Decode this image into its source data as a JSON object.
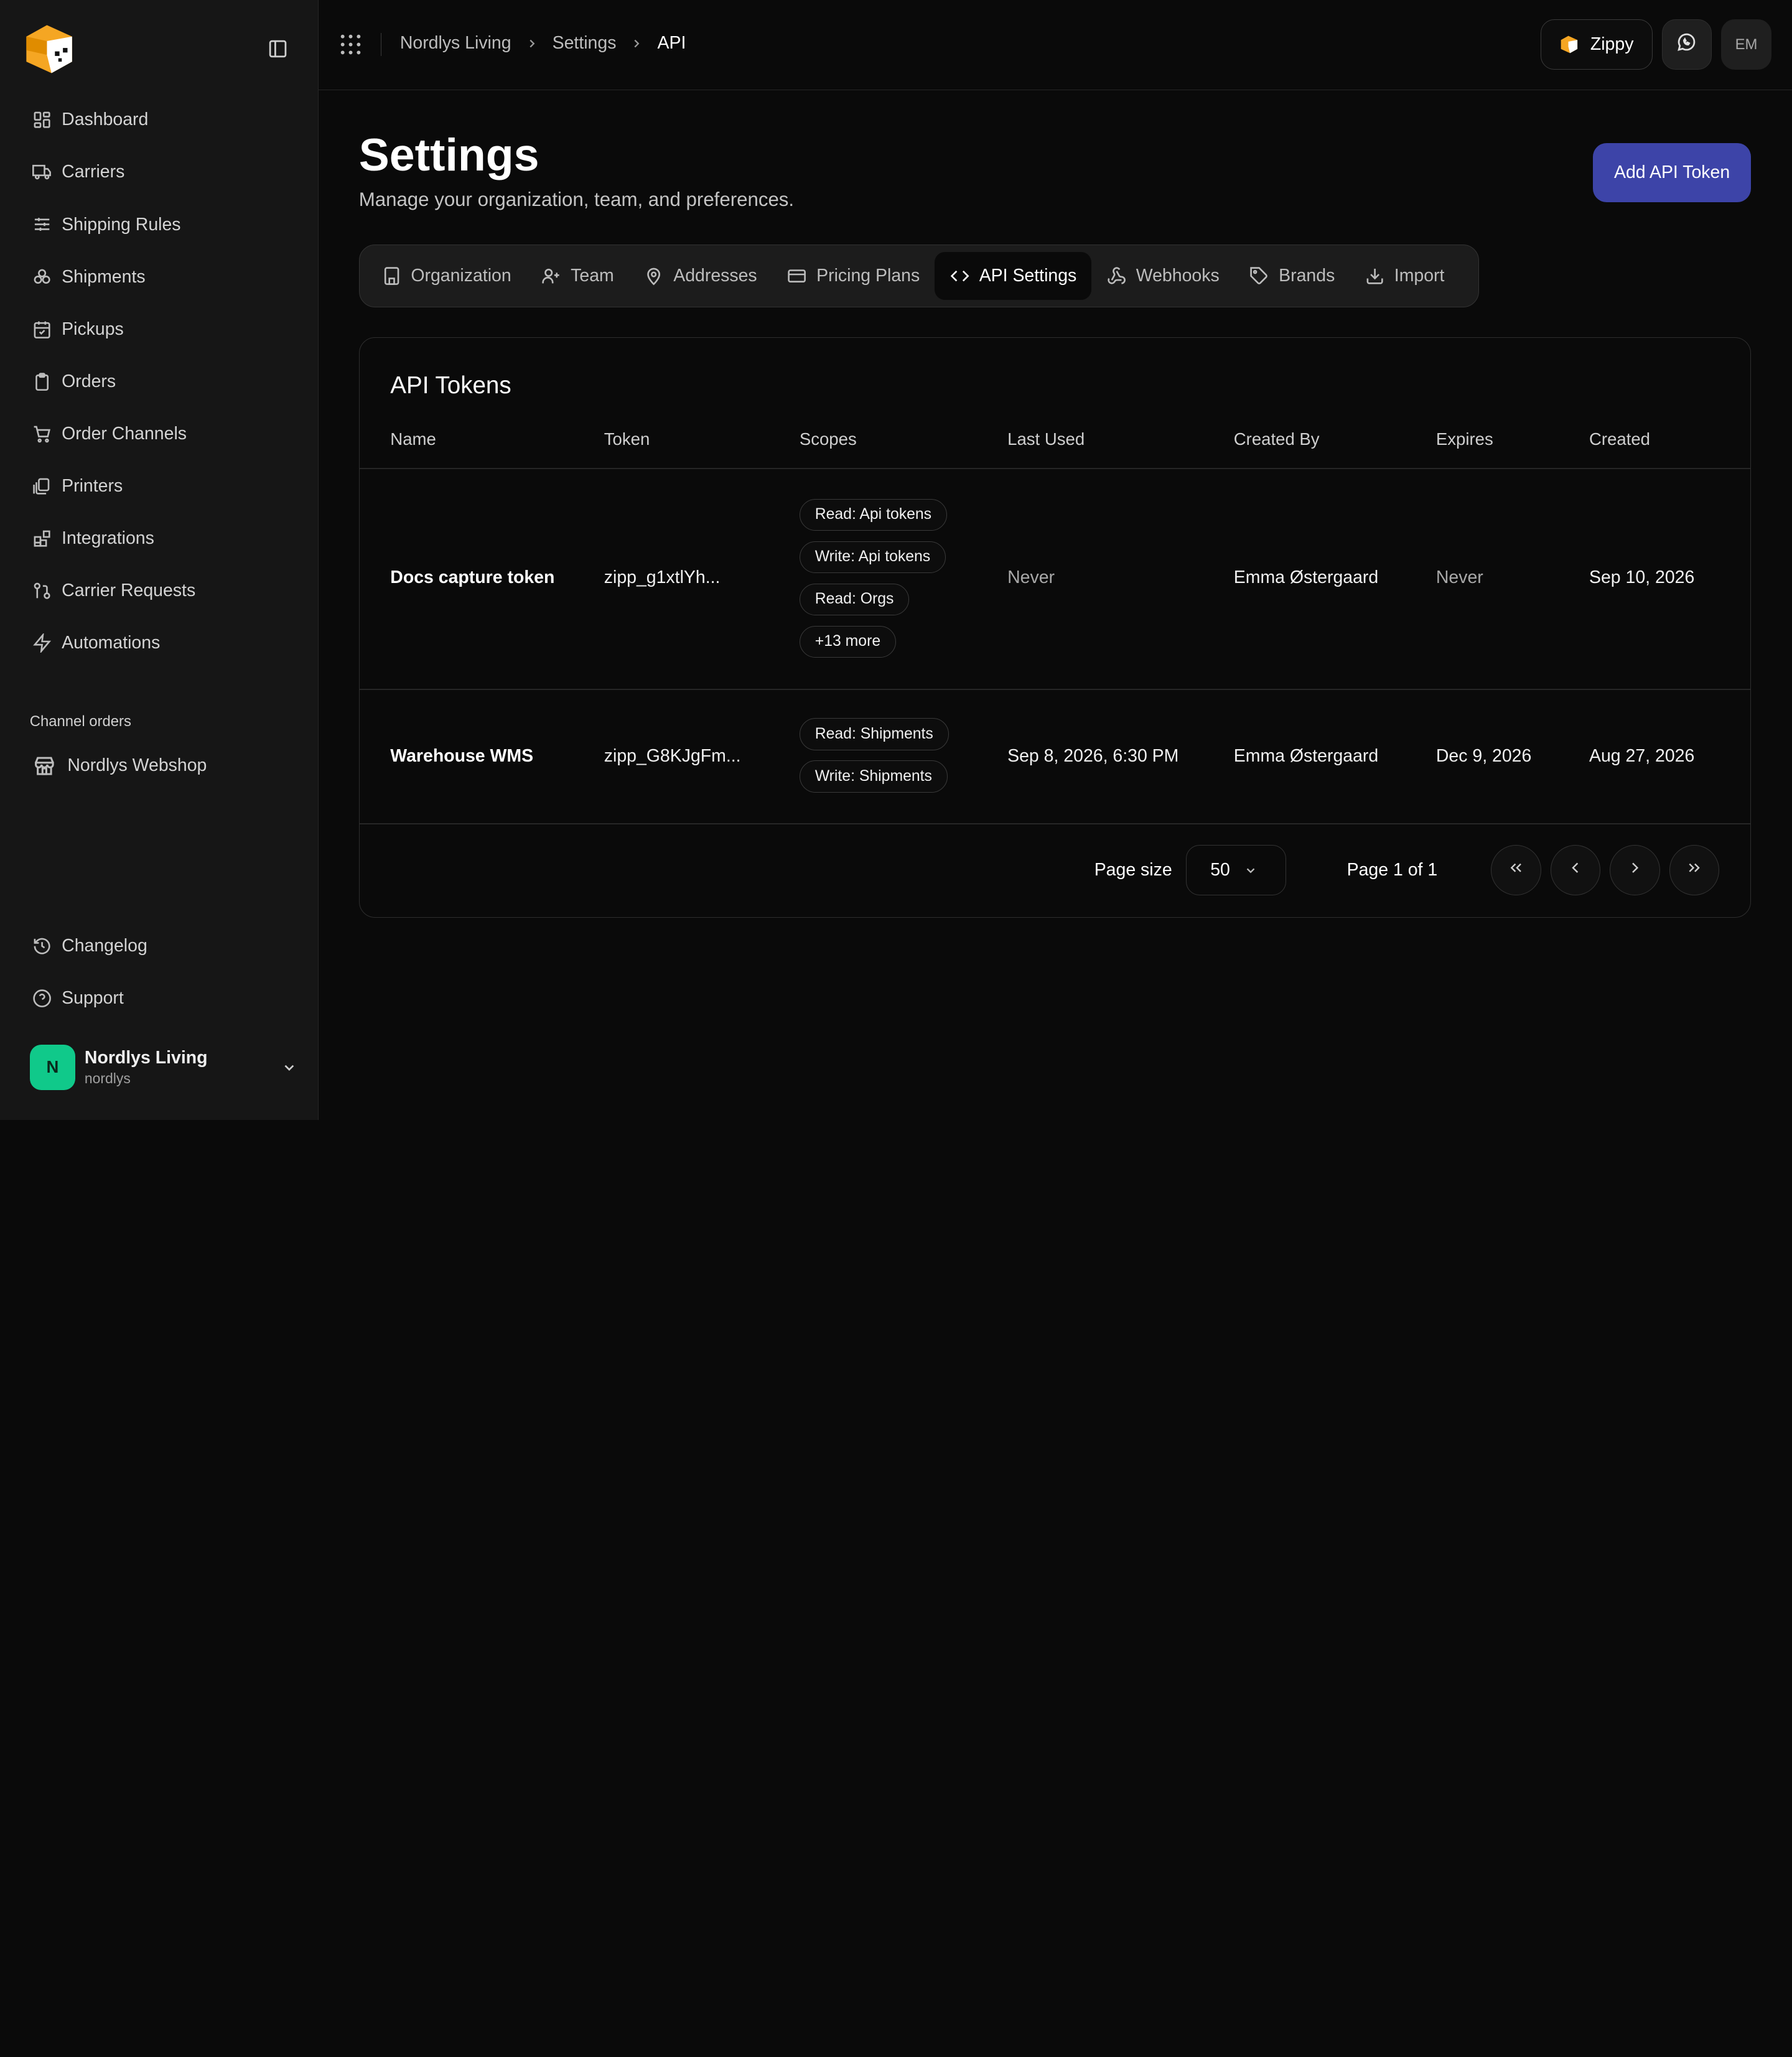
{
  "sidebar": {
    "nav": [
      {
        "label": "Dashboard",
        "icon": "dashboard-icon"
      },
      {
        "label": "Carriers",
        "icon": "truck-icon"
      },
      {
        "label": "Shipping Rules",
        "icon": "sliders-icon"
      },
      {
        "label": "Shipments",
        "icon": "boxes-icon"
      },
      {
        "label": "Pickups",
        "icon": "calendar-check-icon"
      },
      {
        "label": "Orders",
        "icon": "clipboard-icon"
      },
      {
        "label": "Order Channels",
        "icon": "cart-icon"
      },
      {
        "label": "Printers",
        "icon": "printer-icon"
      },
      {
        "label": "Integrations",
        "icon": "blocks-icon"
      },
      {
        "label": "Carrier Requests",
        "icon": "git-pull-icon"
      },
      {
        "label": "Automations",
        "icon": "zap-icon"
      }
    ],
    "channel_section": "Channel orders",
    "channel_item": "Nordlys Webshop",
    "bottom": [
      {
        "label": "Changelog",
        "icon": "history-icon"
      },
      {
        "label": "Support",
        "icon": "help-circle-icon"
      }
    ],
    "org": {
      "initial": "N",
      "name": "Nordlys Living",
      "slug": "nordlys",
      "avatar_color": "#10c98a"
    }
  },
  "topbar": {
    "breadcrumb": [
      "Nordlys Living",
      "Settings",
      "API"
    ],
    "zippy_label": "Zippy",
    "user_initials": "EM"
  },
  "page": {
    "title": "Settings",
    "subtitle": "Manage your organization, team, and preferences.",
    "add_button": "Add API Token",
    "accent": "#3d44a8"
  },
  "tabs": [
    {
      "label": "Organization",
      "icon": "building-icon"
    },
    {
      "label": "Team",
      "icon": "user-plus-icon"
    },
    {
      "label": "Addresses",
      "icon": "map-pin-icon"
    },
    {
      "label": "Pricing Plans",
      "icon": "credit-card-icon"
    },
    {
      "label": "API Settings",
      "icon": "code-icon",
      "active": true
    },
    {
      "label": "Webhooks",
      "icon": "webhook-icon"
    },
    {
      "label": "Brands",
      "icon": "tag-icon"
    },
    {
      "label": "Import",
      "icon": "download-icon"
    }
  ],
  "tokens": {
    "title": "API Tokens",
    "columns": [
      "Name",
      "Token",
      "Scopes",
      "Last Used",
      "Created By",
      "Expires",
      "Created"
    ],
    "rows": [
      {
        "name": "Docs capture token",
        "token": "zipp_g1xtlYh...",
        "scopes": [
          "Read: Api tokens",
          "Write: Api tokens",
          "Read: Orgs",
          "+13 more"
        ],
        "last_used": "Never",
        "created_by": "Emma Østergaard",
        "expires": "Never",
        "created": "Sep 10, 2026"
      },
      {
        "name": "Warehouse WMS",
        "token": "zipp_G8KJgFm...",
        "scopes": [
          "Read: Shipments",
          "Write: Shipments"
        ],
        "last_used": "Sep 8, 2026, 6:30 PM",
        "created_by": "Emma Østergaard",
        "expires": "Dec 9, 2026",
        "created": "Aug 27, 2026"
      }
    ],
    "pagination": {
      "page_size_label": "Page size",
      "page_size": "50",
      "page_info": "Page 1 of 1"
    }
  }
}
